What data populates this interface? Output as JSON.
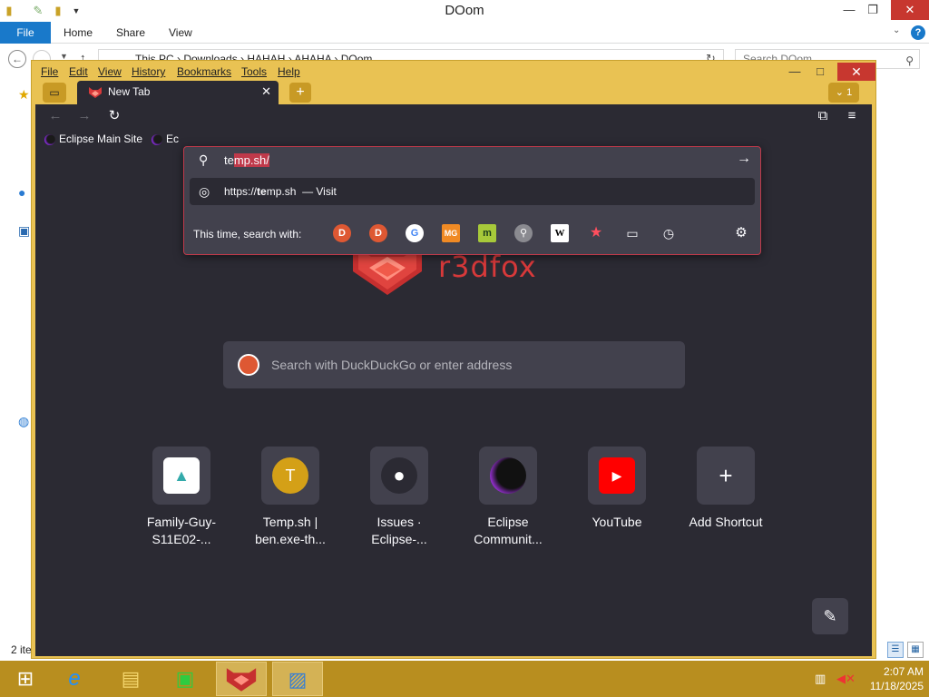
{
  "explorer": {
    "title": "DOom",
    "ribbon_tabs": [
      "File",
      "Home",
      "Share",
      "View"
    ],
    "address_path": "This PC  ›  Downloads  ›  HAHAH  ›  AHAHA  ›  DOom",
    "search_placeholder": "Search DOom",
    "status": "2 ite",
    "minimize": "—",
    "restore": "❐",
    "close": "✕",
    "help": "?"
  },
  "browser": {
    "menu": [
      "File",
      "Edit",
      "View",
      "History",
      "Bookmarks",
      "Tools",
      "Help"
    ],
    "minimize": "—",
    "maximize": "□",
    "close": "✕",
    "tab": {
      "title": "New Tab",
      "close": "✕"
    },
    "new_tab": "+",
    "tab_list": "⌄ 1",
    "bookmarks": [
      "Eclipse Main Site",
      "Ec"
    ],
    "url_bar": {
      "typed": "te",
      "selected": "mp.sh/",
      "result_prefix": "https://",
      "result_bold": "te",
      "result_rest": "mp.sh",
      "result_action": "— Visit",
      "search_with_label": "This time, search with:"
    },
    "brand": "r3dfox",
    "search_placeholder": "Search with DuckDuckGo or enter address",
    "shortcuts": [
      {
        "line1": "Family-Guy-",
        "line2": "S11E02-..."
      },
      {
        "line1": "Temp.sh |",
        "line2": "ben.exe-th...",
        "icon_letter": "T"
      },
      {
        "line1": "Issues ·",
        "line2": "Eclipse-..."
      },
      {
        "line1": "Eclipse",
        "line2": "Communit..."
      },
      {
        "line1": "YouTube",
        "line2": ""
      },
      {
        "line1": "Add Shortcut",
        "line2": ""
      }
    ]
  },
  "taskbar": {
    "time": "2:07 AM",
    "date": "11/18/2025"
  },
  "colors": {
    "browser_frame": "#e9c253",
    "content_bg": "#2b2a33",
    "accent_red": "#d8393a",
    "taskbar": "#b88e1f"
  }
}
